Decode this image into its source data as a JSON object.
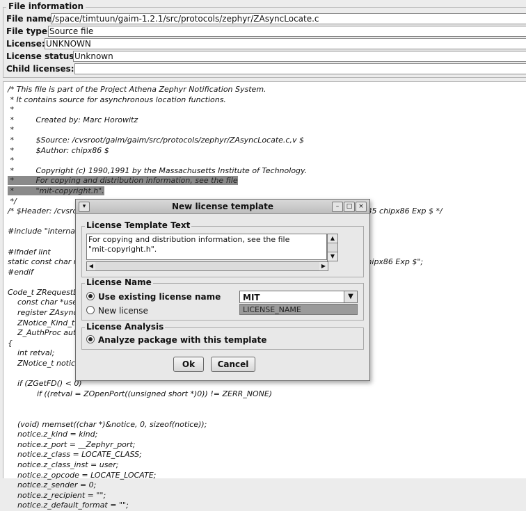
{
  "file_info": {
    "legend": "File information",
    "name_label": "File name:",
    "name_value": "/space/timtuun/gaim-1.2.1/src/protocols/zephyr/ZAsyncLocate.c",
    "type_label": "File type:",
    "type_value": "Source file",
    "license_label": "License:",
    "license_value": "UNKNOWN",
    "status_label": "License status:",
    "status_value": "Unknown",
    "child_label": "Child licenses:",
    "child_value": ""
  },
  "code": {
    "before": "/* This file is part of the Project Athena Zephyr Notification System.\n * It contains source for asynchronous location functions.\n *\n *         Created by: Marc Horowitz\n *\n *         $Source: /cvsroot/gaim/gaim/src/protocols/zephyr/ZAsyncLocate.c,v $\n *         $Author: chipx86 $\n *\n *         Copyright (c) 1990,1991 by the Massachusetts Institute of Technology.\n",
    "hl1": " *         For copying and distribution information, see the file",
    "hl2": " *         \"mit-copyright.h\".",
    "after": " */\n/* $Header: /cvsroot/gaim/gaim/src/protocols/zephyr/ZAsyncLocate.c,v 1.4 2004/04/24 09:00:35 chipx86 Exp $ */\n\n#include \"internal.h\"\n\n#ifndef lint\nstatic const char rcsid_ZAsyncLocate_c[] = \"$Id: ZAsyncLocate.c,v 1.4 2004/04/24 09:00:35 chipx86 Exp $\";\n#endif\n\nCode_t ZRequestLocations(user, zald, kind, auth)\n    const char *user;\n    register ZAsyncLocateData_t *zald;\n    ZNotice_Kind_t kind;\n    Z_AuthProc auth;\n{\n    int retval;\n    ZNotice_t notice;\n\n    if (ZGetFD() < 0)\n            if ((retval = ZOpenPort((unsigned short *)0)) != ZERR_NONE)\n\n\n    (void) memset((char *)&notice, 0, sizeof(notice));\n    notice.z_kind = kind;\n    notice.z_port = __Zephyr_port;\n    notice.z_class = LOCATE_CLASS;\n    notice.z_class_inst = user;\n    notice.z_opcode = LOCATE_LOCATE;\n    notice.z_sender = 0;\n    notice.z_recipient = \"\";\n    notice.z_default_format = \"\";"
  },
  "dialog": {
    "title": "New license template",
    "template_legend": "License Template Text",
    "template_text": "For copying and distribution information, see the file\n\"mit-copyright.h\".",
    "name_legend": "License Name",
    "use_existing_label": "Use existing license name",
    "new_license_label": "New license",
    "selected_license": "MIT",
    "new_license_placeholder": "LICENSE_NAME",
    "analysis_legend": "License Analysis",
    "analyze_label": "Analyze package with this template",
    "ok_label": "Ok",
    "cancel_label": "Cancel"
  }
}
